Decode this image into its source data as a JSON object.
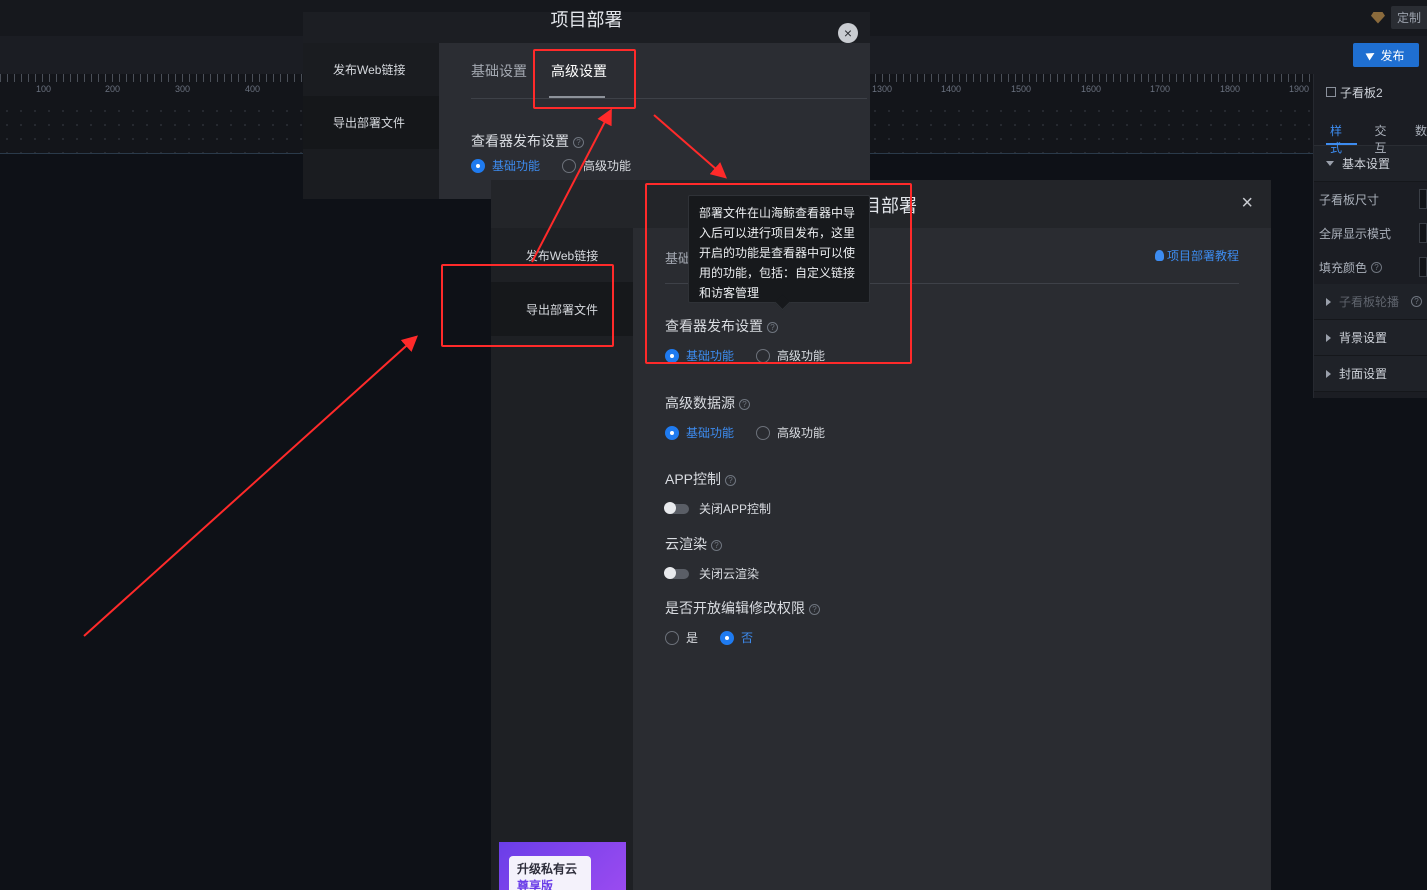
{
  "app": {
    "custom_label": "定制",
    "publish_label": "发布"
  },
  "ruler": {
    "labels": [
      "100",
      "200",
      "300",
      "400",
      "1300",
      "1400",
      "1500",
      "1600",
      "1700",
      "1800",
      "1900"
    ]
  },
  "props": {
    "title": "子看板2",
    "tabs": [
      "样式",
      "交互",
      "数"
    ],
    "section_basic": "基本设置",
    "rows": [
      "子看板尺寸",
      "全屏显示模式",
      "填充颜色"
    ],
    "carousel": "子看板轮播",
    "background": "背景设置",
    "cover": "封面设置"
  },
  "back_dialog": {
    "title": "项目部署",
    "close": "×",
    "side": [
      "发布Web链接",
      "导出部署文件"
    ],
    "tabs": [
      "基础设置",
      "高级设置"
    ],
    "viewer_label": "查看器发布设置",
    "options": [
      "基础功能",
      "高级功能"
    ]
  },
  "dialog": {
    "title": "目部署",
    "close": "×",
    "side": [
      "发布Web链接",
      "导出部署文件"
    ],
    "tab_partial": "基础",
    "tutorial": "项目部署教程",
    "viewer": {
      "label": "查看器发布设置",
      "options": [
        "基础功能",
        "高级功能"
      ]
    },
    "datasource": {
      "label": "高级数据源",
      "options": [
        "基础功能",
        "高级功能"
      ]
    },
    "app_control": {
      "label": "APP控制",
      "switch": "关闭APP控制"
    },
    "cloud": {
      "label": "云渲染",
      "switch": "关闭云渲染"
    },
    "edit": {
      "label": "是否开放编辑修改权限",
      "options": [
        "是",
        "否"
      ]
    },
    "promo": {
      "line1": "升级私有云",
      "line2": "尊享版"
    }
  },
  "tooltip": {
    "text": "部署文件在山海鲸查看器中导入后可以进行项目发布，这里开启的功能是查看器中可以使用的功能，包括：自定义链接和访客管理"
  },
  "colors": {
    "accent": "#1f7bf0",
    "annotation": "#ff2a2a"
  }
}
